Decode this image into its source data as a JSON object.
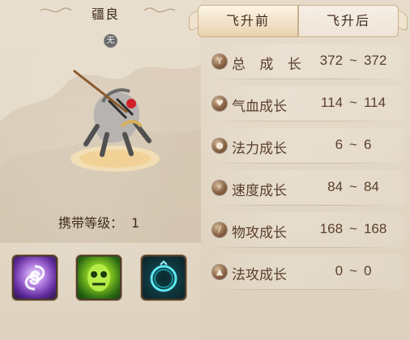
{
  "pet": {
    "name": "疆良",
    "attribute_badge": "无",
    "carry_level_label": "携带等级：",
    "carry_level_value": "1",
    "skills": [
      {
        "icon": "purple-swirl-skill-icon"
      },
      {
        "icon": "green-ghost-skill-icon"
      },
      {
        "icon": "teal-ring-skill-icon"
      }
    ]
  },
  "tabs": [
    {
      "label": "飞升前",
      "active": true
    },
    {
      "label": "飞升后",
      "active": false
    }
  ],
  "stats": [
    {
      "icon": "total-growth-icon",
      "label": "总 成 长",
      "min": "372",
      "max": "372"
    },
    {
      "icon": "hp-growth-icon",
      "label": "气血成长",
      "min": "114",
      "max": "114"
    },
    {
      "icon": "mana-growth-icon",
      "label": "法力成长",
      "min": "6",
      "max": "6"
    },
    {
      "icon": "speed-growth-icon",
      "label": "速度成长",
      "min": "84",
      "max": "84"
    },
    {
      "icon": "physical-attack-growth-icon",
      "label": "物攻成长",
      "min": "168",
      "max": "168"
    },
    {
      "icon": "magic-attack-growth-icon",
      "label": "法攻成长",
      "min": "0",
      "max": "0"
    }
  ],
  "range_separator": "~",
  "colors": {
    "text": "#5a3f2c",
    "tab_border": "#c9b08a",
    "icon_brown": "#8a6445"
  }
}
